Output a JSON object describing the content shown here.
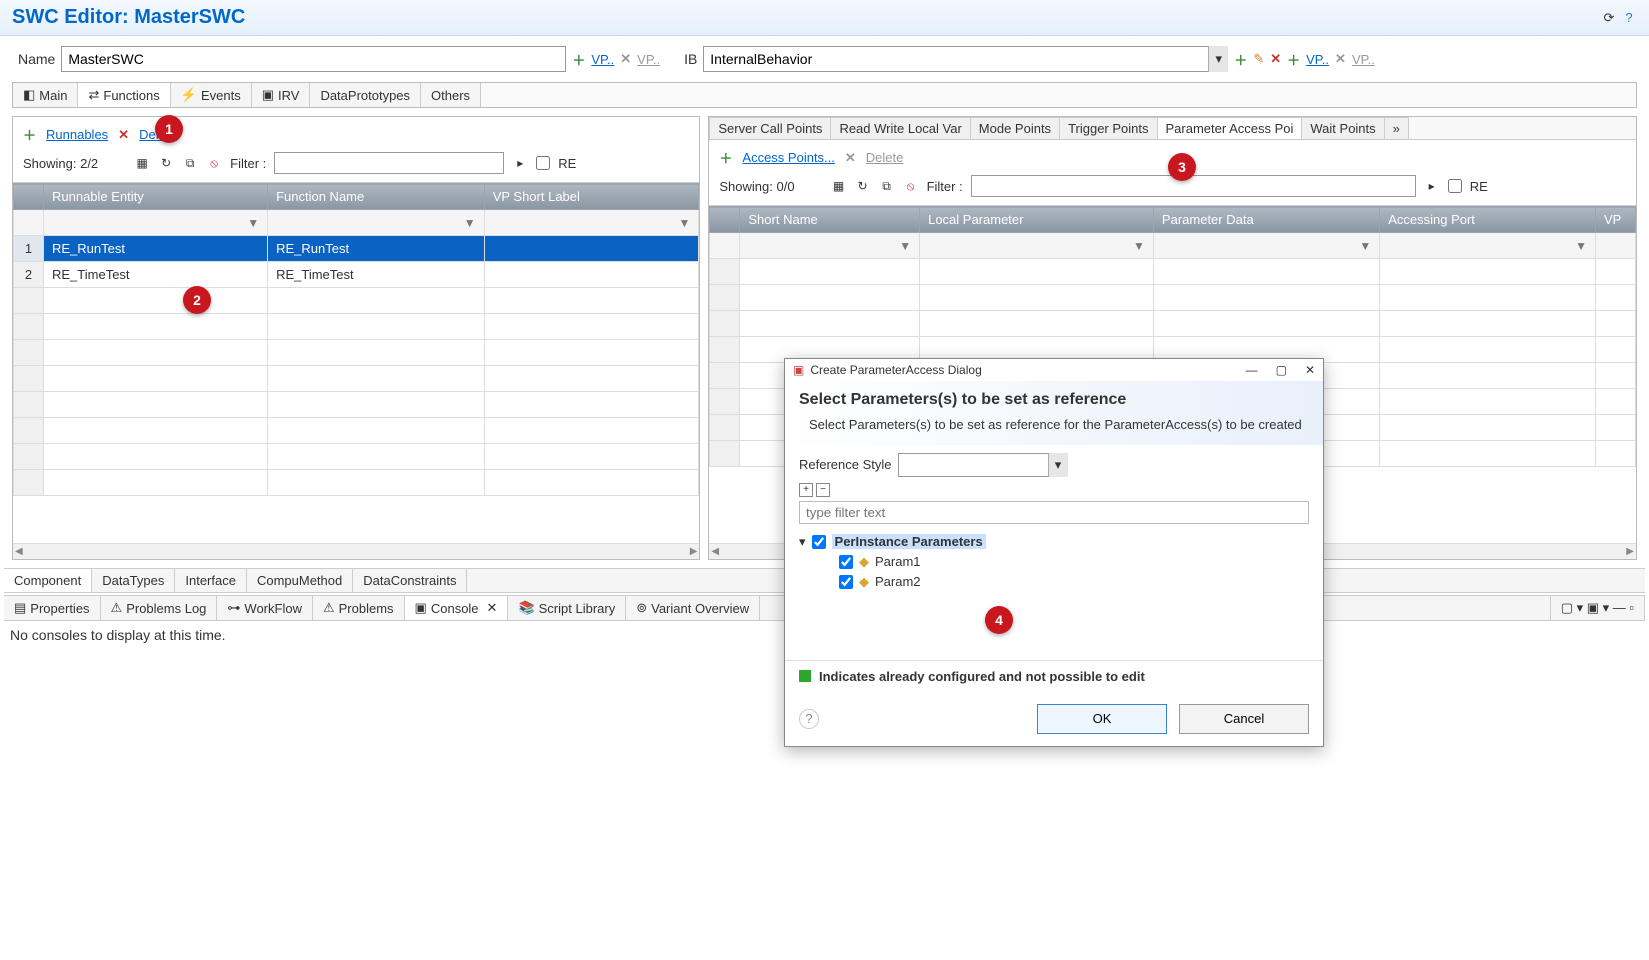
{
  "title": "SWC Editor: MasterSWC",
  "name_label": "Name",
  "name_value": "MasterSWC",
  "vp_link": "VP..",
  "ib_label": "IB",
  "ib_value": "InternalBehavior",
  "main_tabs": [
    "Main",
    "Functions",
    "Events",
    "IRV",
    "DataPrototypes",
    "Others"
  ],
  "left": {
    "runnables_link": "Runnables",
    "delete_link": "Delete",
    "showing": "Showing: 2/2",
    "filter_label": "Filter :",
    "re_label": "RE",
    "columns": [
      "Runnable Entity",
      "Function Name",
      "VP Short Label"
    ],
    "rows": [
      {
        "num": "1",
        "entity": "RE_RunTest",
        "func": "RE_RunTest",
        "vp": ""
      },
      {
        "num": "2",
        "entity": "RE_TimeTest",
        "func": "RE_TimeTest",
        "vp": ""
      }
    ]
  },
  "right": {
    "sub_tabs": [
      "Server Call Points",
      "Read Write Local Var",
      "Mode Points",
      "Trigger Points",
      "Parameter Access Poi",
      "Wait Points"
    ],
    "access_link": "Access Points...",
    "delete_link": "Delete",
    "showing": "Showing: 0/0",
    "filter_label": "Filter :",
    "re_label": "RE",
    "columns": [
      "Short Name",
      "Local Parameter",
      "Parameter Data",
      "Accessing Port",
      "VP"
    ]
  },
  "bottom_tabs1": [
    "Component",
    "DataTypes",
    "Interface",
    "CompuMethod",
    "DataConstraints"
  ],
  "bottom_tabs2": [
    "Properties",
    "Problems Log",
    "WorkFlow",
    "Problems",
    "Console",
    "Script Library",
    "Variant Overview"
  ],
  "console_msg": "No consoles to display at this time.",
  "dialog": {
    "title": "Create ParameterAccess Dialog",
    "heading": "Select Parameters(s) to be set as reference",
    "desc": "Select Parameters(s) to be set as reference for the ParameterAccess(s) to be created",
    "ref_label": "Reference Style",
    "filter_placeholder": "type filter text",
    "root": "PerInstance Parameters",
    "items": [
      "Param1",
      "Param2"
    ],
    "note": "Indicates already configured and not possible to edit",
    "ok": "OK",
    "cancel": "Cancel"
  },
  "annotations": [
    "1",
    "2",
    "3",
    "4"
  ]
}
